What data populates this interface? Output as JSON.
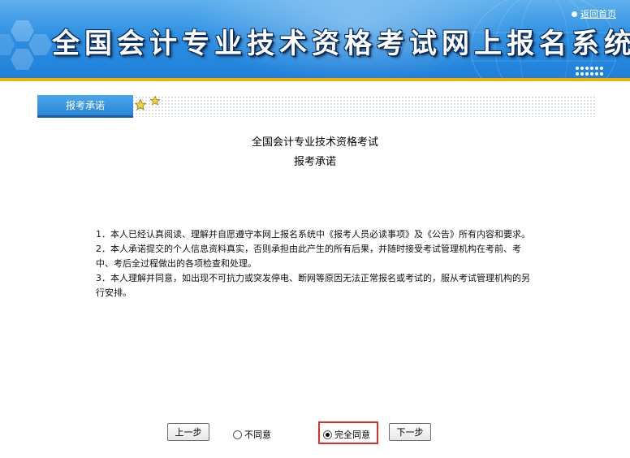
{
  "header": {
    "title": "全国会计专业技术资格考试网上报名系统",
    "home_link": "返回首页"
  },
  "tab": {
    "label": "报考承诺"
  },
  "content": {
    "heading": "全国会计专业技术资格考试",
    "subheading": "报考承诺",
    "terms": [
      "1．本人已经认真阅读、理解并自愿遵守本网上报名系统中《报考人员必读事项》及《公告》所有内容和要求。",
      "2．本人承诺提交的个人信息资料真实，否则承担由此产生的所有后果，并随时接受考试管理机构在考前、考中、考后全过程做出的各项检查和处理。",
      "3．本人理解并同意，如出现不可抗力或突发停电、断网等原因无法正常报名或考试的，服从考试管理机构的另行安排。"
    ]
  },
  "controls": {
    "prev_button": "上一步",
    "disagree_label": "不同意",
    "agree_label": "完全同意",
    "next_button": "下一步",
    "selected": "agree"
  },
  "colors": {
    "banner_blue": "#2c8fe2",
    "banner_accent": "#f0b400",
    "tab_blue": "#2b86d6",
    "highlight_red": "#d9302a"
  }
}
